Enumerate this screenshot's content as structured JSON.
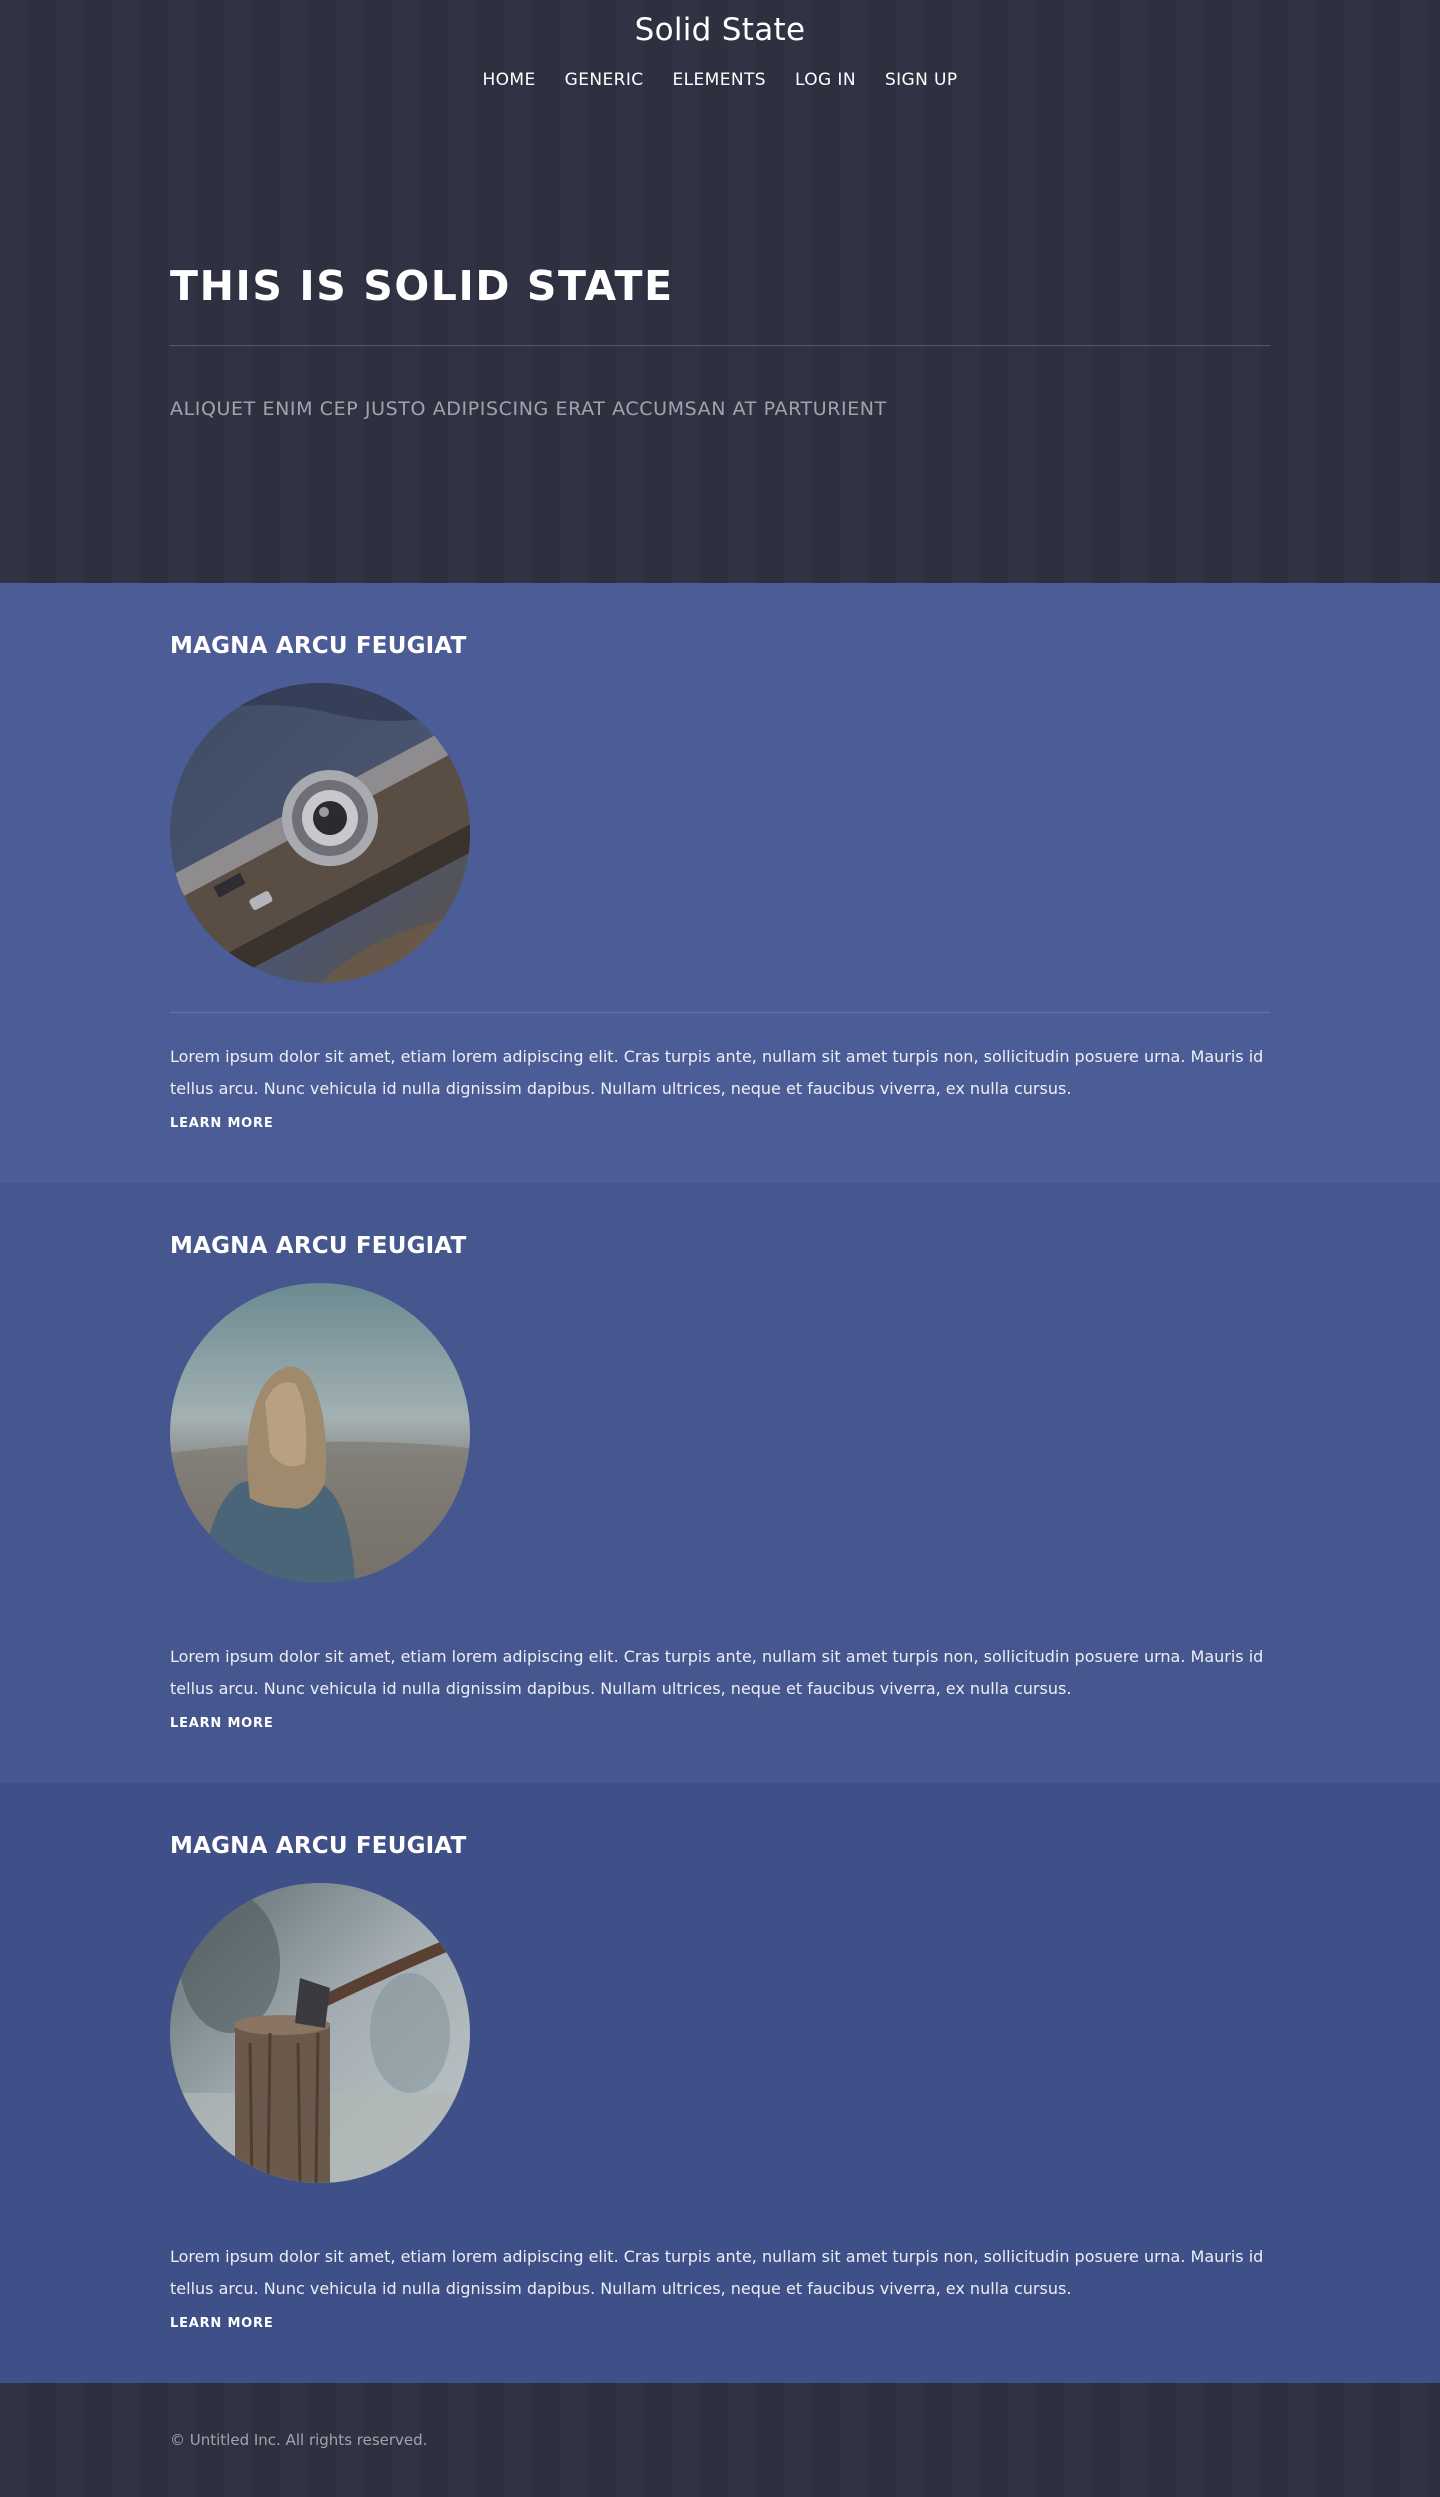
{
  "site": {
    "title": "Solid State"
  },
  "nav": {
    "items": [
      "HOME",
      "GENERIC",
      "ELEMENTS",
      "LOG IN",
      "SIGN UP"
    ]
  },
  "hero": {
    "title": "THIS IS SOLID STATE",
    "subtitle": "ALIQUET ENIM CEP JUSTO ADIPISCING ERAT ACCUMSAN AT PARTURIENT"
  },
  "sections": [
    {
      "heading": "MAGNA ARCU FEUGIAT",
      "image": "camera-photo",
      "text": "Lorem ipsum dolor sit amet, etiam lorem adipiscing elit. Cras turpis ante, nullam sit amet turpis non, sollicitudin posuere urna. Mauris id tellus arcu. Nunc vehicula id nulla dignissim dapibus. Nullam ultrices, neque et faucibus viverra, ex nulla cursus.",
      "link": "LEARN MORE"
    },
    {
      "heading": "MAGNA ARCU FEUGIAT",
      "image": "woman-landscape-photo",
      "text": "Lorem ipsum dolor sit amet, etiam lorem adipiscing elit. Cras turpis ante, nullam sit amet turpis non, sollicitudin posuere urna. Mauris id tellus arcu. Nunc vehicula id nulla dignissim dapibus. Nullam ultrices, neque et faucibus viverra, ex nulla cursus.",
      "link": "LEARN MORE"
    },
    {
      "heading": "MAGNA ARCU FEUGIAT",
      "image": "axe-stump-photo",
      "text": "Lorem ipsum dolor sit amet, etiam lorem adipiscing elit. Cras turpis ante, nullam sit amet turpis non, sollicitudin posuere urna. Mauris id tellus arcu. Nunc vehicula id nulla dignissim dapibus. Nullam ultrices, neque et faucibus viverra, ex nulla cursus.",
      "link": "LEARN MORE"
    }
  ],
  "footer": {
    "copyright": "© Untitled Inc. All rights reserved."
  },
  "colors": {
    "header_bg": "#2e3141",
    "section_1_bg": "#4c5c96",
    "section_2_bg": "#46568e",
    "section_3_bg": "#3f4f87"
  }
}
